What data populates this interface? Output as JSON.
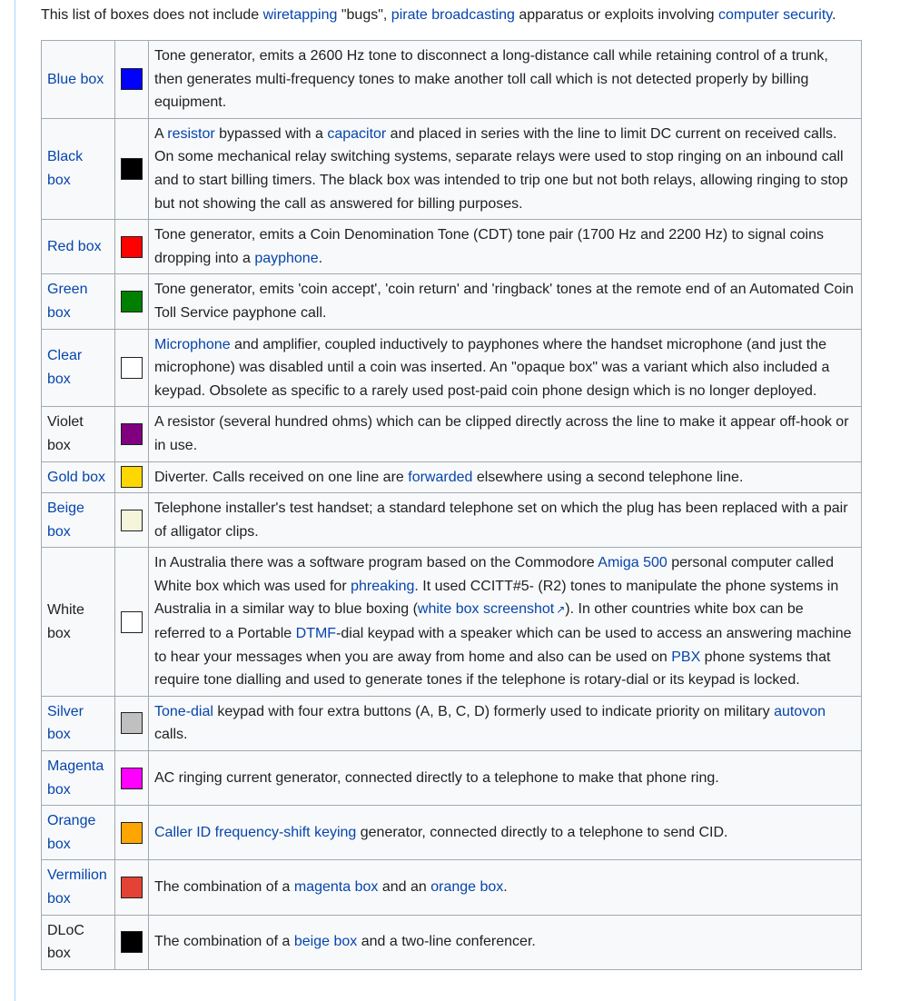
{
  "intro": {
    "t1": "This list of boxes does not include ",
    "l1": "wiretapping",
    "t2": " \"bugs\", ",
    "l2": "pirate broadcasting",
    "t3": " apparatus or exploits involving ",
    "l3": "computer security",
    "t4": "."
  },
  "rows": [
    {
      "name": "Blue box",
      "link": true,
      "color": "#0000ff",
      "desc": [
        {
          "t": "Tone generator, emits a 2600 Hz tone to disconnect a long-distance call while retaining control of a trunk, then generates multi-frequency tones to make another toll call which is not detected properly by billing equipment."
        }
      ]
    },
    {
      "name": "Black box",
      "link": true,
      "color": "#000000",
      "desc": [
        {
          "t": "A "
        },
        {
          "l": "resistor"
        },
        {
          "t": " bypassed with a "
        },
        {
          "l": "capacitor"
        },
        {
          "t": " and placed in series with the line to limit DC current on received calls. On some mechanical relay switching systems, separate relays were used to stop ringing on an inbound call and to start billing timers. The black box was intended to trip one but not both relays, allowing ringing to stop but not showing the call as answered for billing purposes."
        }
      ]
    },
    {
      "name": "Red box",
      "link": true,
      "color": "#ff0000",
      "desc": [
        {
          "t": "Tone generator, emits a Coin Denomination Tone (CDT) tone pair (1700 Hz and 2200 Hz) to signal coins dropping into a "
        },
        {
          "l": "payphone"
        },
        {
          "t": "."
        }
      ]
    },
    {
      "name": "Green box",
      "link": true,
      "color": "#008000",
      "desc": [
        {
          "t": "Tone generator, emits 'coin accept', 'coin return' and 'ringback' tones at the remote end of an Automated Coin Toll Service payphone call."
        }
      ]
    },
    {
      "name": "Clear box",
      "link": true,
      "color": "#ffffff",
      "desc": [
        {
          "l": "Microphone"
        },
        {
          "t": " and amplifier, coupled inductively to payphones where the handset microphone (and just the microphone) was disabled until a coin was inserted. An \"opaque box\" was a variant which also included a keypad. Obsolete as specific to a rarely used post-paid coin phone design which is no longer deployed."
        }
      ]
    },
    {
      "name": "Violet box",
      "link": false,
      "color": "#800080",
      "desc": [
        {
          "t": "A resistor (several hundred ohms) which can be clipped directly across the line to make it appear off-hook or in use."
        }
      ]
    },
    {
      "name": "Gold box",
      "link": true,
      "color": "#ffd700",
      "desc": [
        {
          "t": "Diverter. Calls received on one line are "
        },
        {
          "l": "forwarded"
        },
        {
          "t": " elsewhere using a second telephone line."
        }
      ]
    },
    {
      "name": "Beige box",
      "link": true,
      "color": "#f5f5dc",
      "desc": [
        {
          "t": "Telephone installer's test handset; a standard telephone set on which the plug has been replaced with a pair of alligator clips."
        }
      ]
    },
    {
      "name": "White box",
      "link": false,
      "color": "#ffffff",
      "desc": [
        {
          "t": "In Australia there was a software program based on the Commodore "
        },
        {
          "l": "Amiga 500"
        },
        {
          "t": " personal computer called White box which was used for "
        },
        {
          "l": "phreaking"
        },
        {
          "t": ". It used CCITT#5- (R2) tones to manipulate the phone systems in Australia in a similar way to blue boxing ("
        },
        {
          "l": "white box screenshot",
          "ext": true
        },
        {
          "t": "). In other countries white box can be referred to a Portable "
        },
        {
          "l": "DTMF"
        },
        {
          "t": "-dial keypad with a speaker which can be used to access an answering machine to hear your messages when you are away from home and also can be used on "
        },
        {
          "l": "PBX"
        },
        {
          "t": " phone systems that require tone dialling and used to generate tones if the telephone is rotary-dial or its keypad is locked."
        }
      ]
    },
    {
      "name": "Silver box",
      "link": true,
      "color": "#c0c0c0",
      "desc": [
        {
          "l": "Tone-dial"
        },
        {
          "t": " keypad with four extra buttons (A, B, C, D) formerly used to indicate priority on military "
        },
        {
          "l": "autovon"
        },
        {
          "t": " calls."
        }
      ]
    },
    {
      "name": "Magenta box",
      "link": true,
      "color": "#ff00ff",
      "desc": [
        {
          "t": "AC ringing current generator, connected directly to a telephone to make that phone ring."
        }
      ]
    },
    {
      "name": "Orange box",
      "link": true,
      "color": "#ffa500",
      "desc": [
        {
          "l": "Caller ID frequency-shift keying"
        },
        {
          "t": " generator, connected directly to a telephone to send CID."
        }
      ]
    },
    {
      "name": "Vermilion box",
      "link": true,
      "color": "#e34234",
      "desc": [
        {
          "t": "The combination of a "
        },
        {
          "l": "magenta box"
        },
        {
          "t": " and an "
        },
        {
          "l": "orange box"
        },
        {
          "t": "."
        }
      ]
    },
    {
      "name": "DLoC box",
      "link": false,
      "color": "#000000",
      "desc": [
        {
          "t": "The combination of a "
        },
        {
          "l": "beige box"
        },
        {
          "t": " and a two-line conferencer."
        }
      ]
    }
  ],
  "icons": {
    "external_link": "external-link-icon"
  }
}
